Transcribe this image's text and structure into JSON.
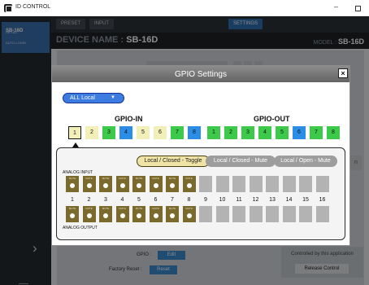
{
  "app": {
    "title": "ID CONTROL"
  },
  "sidebar": {
    "device_name": "SB-16D",
    "device_sub1": "SB-16D",
    "device_sub2": "AUTO-LOGIN"
  },
  "tabs": {
    "preset": "PRESET",
    "input": "INPUT",
    "settings": "SETTINGS"
  },
  "device_bar": {
    "prefix": "DEVICE NAME : ",
    "name": "SB-16D",
    "model_prefix": "MODEL : ",
    "model": "SB-16D"
  },
  "background": {
    "gpio_label": "GPIO :",
    "gpio_button": "Edit",
    "factory_label": "Factory Reset :",
    "factory_button": "Reset",
    "controlled_text": "Controlled by this application",
    "release_button": "Release Control",
    "side_button_text": "n"
  },
  "modal": {
    "title": "GPIO Settings",
    "close_label": "×",
    "dropdown_value": "ALL Local",
    "gpio_in_title": "GPIO-IN",
    "gpio_out_title": "GPIO-OUT",
    "selected_gpio_in": 1,
    "gpio_in": [
      {
        "label": "1",
        "color": "#f3efb8"
      },
      {
        "label": "2",
        "color": "#f3efb8"
      },
      {
        "label": "3",
        "color": "#3dc94a"
      },
      {
        "label": "4",
        "color": "#2c8de6"
      },
      {
        "label": "5",
        "color": "#f3efb8"
      },
      {
        "label": "6",
        "color": "#f3efb8"
      },
      {
        "label": "7",
        "color": "#3dc94a"
      },
      {
        "label": "8",
        "color": "#2c8de6"
      }
    ],
    "gpio_out": [
      {
        "label": "1",
        "color": "#3dc94a"
      },
      {
        "label": "2",
        "color": "#3dc94a"
      },
      {
        "label": "3",
        "color": "#3dc94a"
      },
      {
        "label": "4",
        "color": "#3dc94a"
      },
      {
        "label": "5",
        "color": "#3dc94a"
      },
      {
        "label": "6",
        "color": "#2c8de6"
      },
      {
        "label": "7",
        "color": "#3dc94a"
      },
      {
        "label": "8",
        "color": "#3dc94a"
      }
    ],
    "modes": {
      "toggle": "Local / Closed - Toggle",
      "mute": "Local / Closed - Mute",
      "open_mute": "Local / Open - Mute",
      "active": "toggle"
    },
    "analog_input_label": "ANALOG INPUT",
    "analog_output_label": "ANALOG OUTPUT",
    "mute_label": "MUTE",
    "channel_numbers": [
      "1",
      "2",
      "3",
      "4",
      "5",
      "6",
      "7",
      "8",
      "9",
      "10",
      "11",
      "12",
      "13",
      "14",
      "15",
      "16"
    ],
    "muted_channels": 8
  },
  "colors": {
    "accent_blue": "#3c7be0",
    "mute_on": "#7a6a2c",
    "mute_off": "#b3b3b3"
  }
}
